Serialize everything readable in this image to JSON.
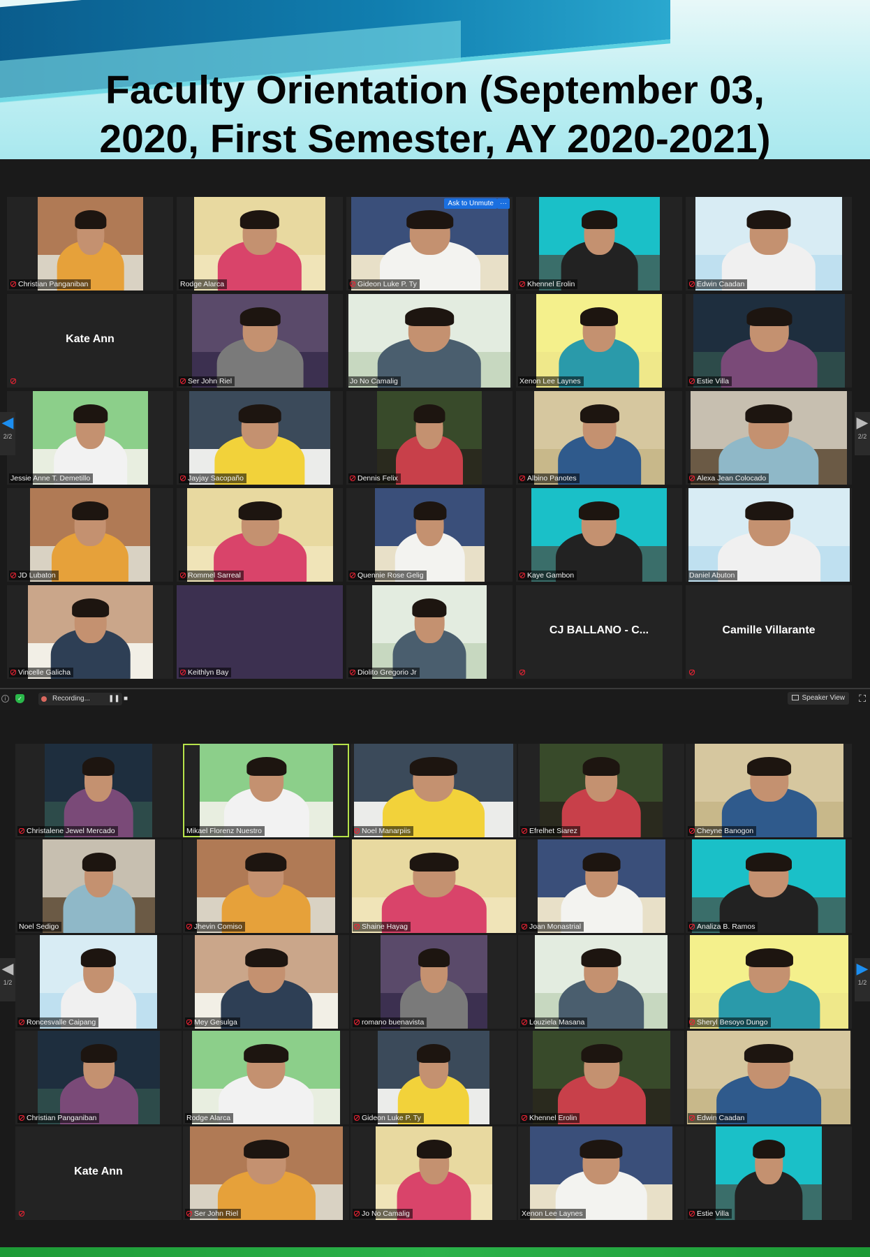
{
  "header": {
    "title_line1": "Faculty Orientation (September 03,",
    "title_line2": "2020, First Semester, AY 2020-2021)"
  },
  "screenshot1": {
    "participants": [
      {
        "name": "Christian Panganiban",
        "muted": true
      },
      {
        "name": "Rodge Alarca",
        "muted": false
      },
      {
        "name": "Gideon Luke P. Ty",
        "muted": true
      },
      {
        "name": "Khennel Erolin",
        "muted": true
      },
      {
        "name": "Edwin Caadan",
        "muted": true
      },
      {
        "name": "Kate Ann",
        "muted": true,
        "video_off": true
      },
      {
        "name": "Ser John Riel",
        "muted": true
      },
      {
        "name": "Jo No Camalig",
        "muted": false
      },
      {
        "name": "Xenon Lee Laynes",
        "muted": false
      },
      {
        "name": "Estie Villa",
        "muted": true
      },
      {
        "name": "Jessie Anne T. Demetillo",
        "muted": false
      },
      {
        "name": "Jayjay Sacopaño",
        "muted": true
      },
      {
        "name": "Dennis Felix",
        "muted": true
      },
      {
        "name": "Albino Panotes",
        "muted": true
      },
      {
        "name": "Alexa Jean Colocado",
        "muted": true
      },
      {
        "name": "JD Lubaton",
        "muted": true
      },
      {
        "name": "Rommel Sarreal",
        "muted": true
      },
      {
        "name": "Quennie Rose Gelig",
        "muted": true
      },
      {
        "name": "Kaye Gambon",
        "muted": true
      },
      {
        "name": "Daniel Abuton",
        "muted": false
      },
      {
        "name": "Vincelle Galicha",
        "muted": true
      },
      {
        "name": "Keithlyn Bay",
        "muted": true,
        "orange": true
      },
      {
        "name": "Diolito Gregorio Jr",
        "muted": true
      },
      {
        "name": "CJ BALLANO - C...",
        "muted": true,
        "video_off": true
      },
      {
        "name": "Camille Villarante",
        "muted": true,
        "video_off": true
      }
    ],
    "ask_to_unmute": "Ask to Unmute",
    "more_label": "···",
    "page_left": "2/2",
    "page_right": "2/2"
  },
  "toolbar": {
    "recording_label": "Recording...",
    "pause_icon": "❚❚",
    "stop_icon": "■",
    "speaker_view_label": "Speaker View",
    "fullscreen_icon": "⛶",
    "info_icon": "i",
    "shield_icon": "✓"
  },
  "screenshot2": {
    "participants": [
      {
        "name": "Christalene Jewel Mercado",
        "muted": true
      },
      {
        "name": "Mikael Florenz Nuestro",
        "muted": false,
        "active": true
      },
      {
        "name": "Noel Manarpiis",
        "muted": true
      },
      {
        "name": "Efrelhet Siarez",
        "muted": true
      },
      {
        "name": "Cheyne Banogon",
        "muted": true
      },
      {
        "name": "Noel Sedigo",
        "muted": false
      },
      {
        "name": "Jhevin Comiso",
        "muted": true
      },
      {
        "name": "Shaine Hayag",
        "muted": true
      },
      {
        "name": "Joan Monastrial",
        "muted": true
      },
      {
        "name": "Analiza B. Ramos",
        "muted": true
      },
      {
        "name": "Roncesvalle Caipang",
        "muted": true
      },
      {
        "name": "Mey Gesulga",
        "muted": true
      },
      {
        "name": "romano buenavista",
        "muted": true
      },
      {
        "name": "Louziela Masana",
        "muted": true
      },
      {
        "name": "Sheryl Besoyo Dungo",
        "muted": true
      },
      {
        "name": "Christian Panganiban",
        "muted": true
      },
      {
        "name": "Rodge Alarca",
        "muted": false
      },
      {
        "name": "Gideon Luke P. Ty",
        "muted": true
      },
      {
        "name": "Khennel Erolin",
        "muted": true
      },
      {
        "name": "Edwin Caadan",
        "muted": true
      },
      {
        "name": "Kate Ann",
        "muted": true,
        "video_off": true
      },
      {
        "name": "Ser John Riel",
        "muted": true
      },
      {
        "name": "Jo No Camalig",
        "muted": true
      },
      {
        "name": "Xenon Lee Laynes",
        "muted": false
      },
      {
        "name": "Estie Villa",
        "muted": true
      }
    ],
    "page_left": "1/2",
    "page_right": "1/2"
  },
  "colors": {
    "meeting_bg": "#1a1a1a",
    "tile_bg": "#232323",
    "active_speaker_border": "#b6e34a",
    "unmute_blue": "#1a6fe0",
    "footer_green": "#2bb24a"
  }
}
